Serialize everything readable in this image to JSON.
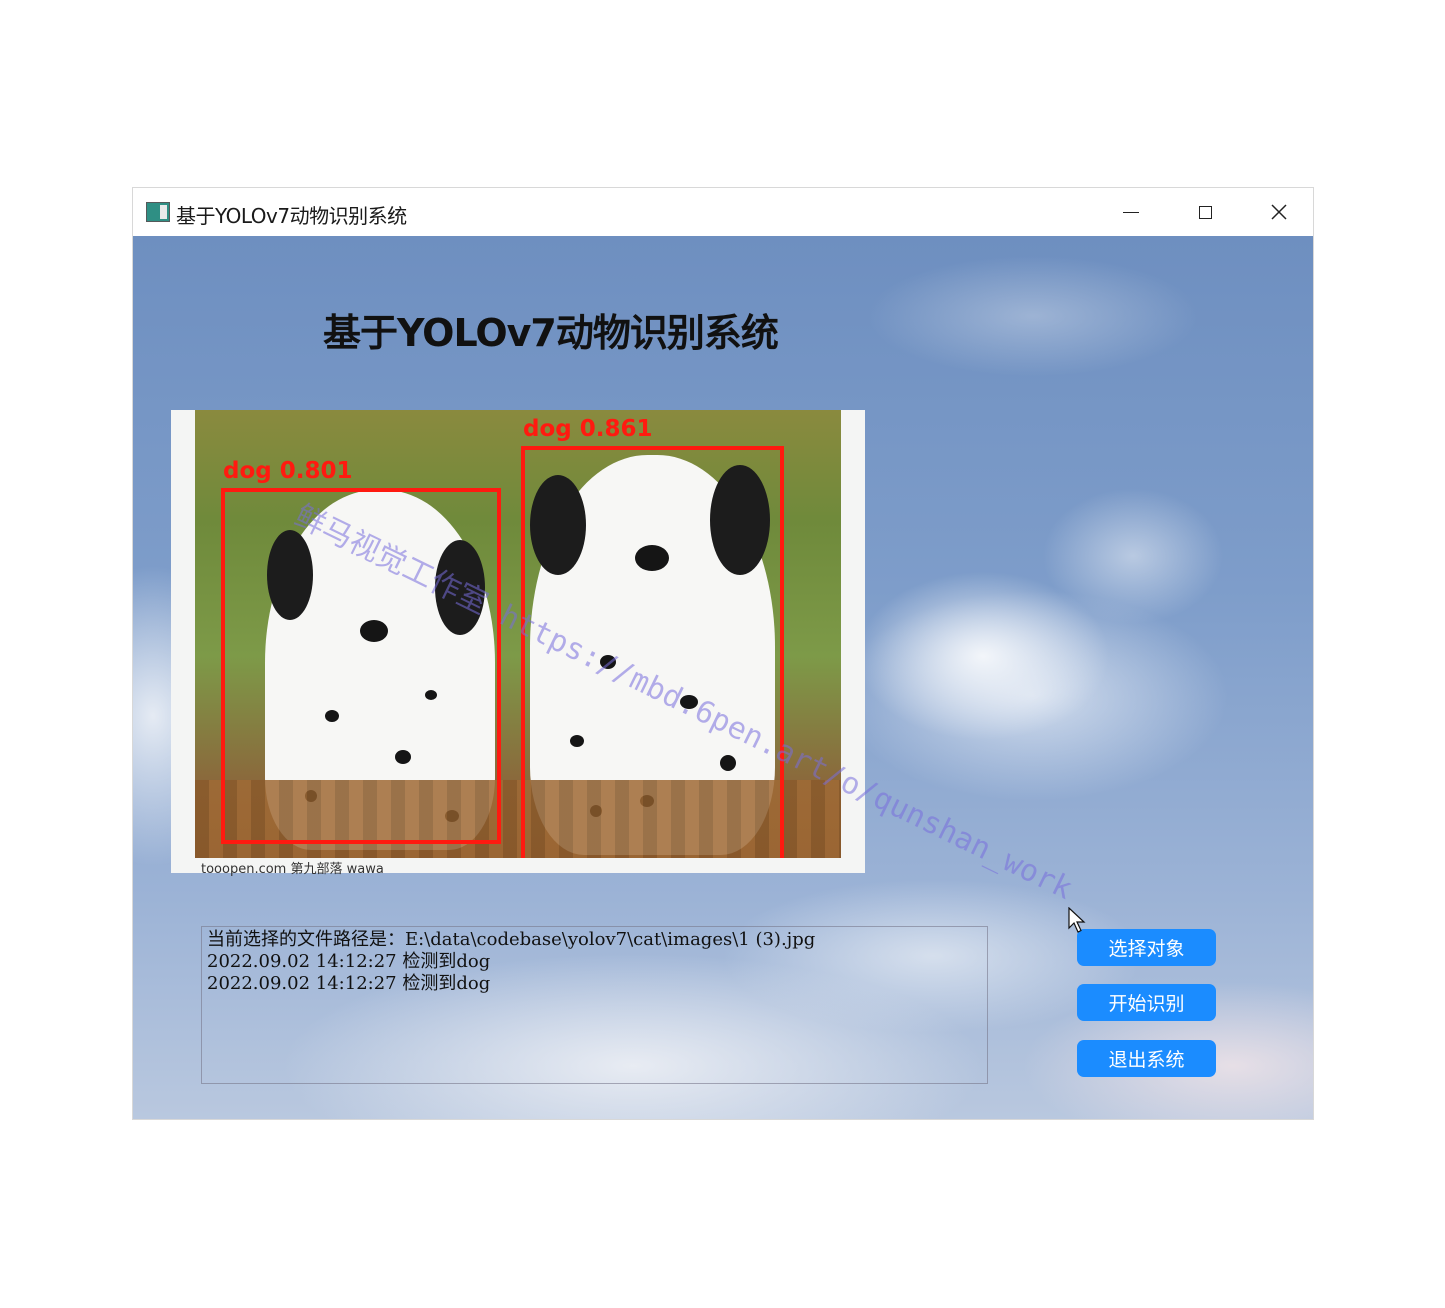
{
  "window": {
    "title": "基于YOLOv7动物识别系统",
    "controls": [
      "minimize",
      "maximize",
      "close"
    ]
  },
  "app": {
    "title": "基于YOLOv7动物识别系统"
  },
  "detection": {
    "boxes": [
      {
        "label": "dog 0.801"
      },
      {
        "label": "dog 0.861"
      }
    ],
    "box_color": "#ff1a10",
    "image_credit": "tooopen.com 第九部落  wawa",
    "watermark": "鲜马视觉工作室 https://mbd.6pen.art/o/qunshan_work"
  },
  "log": {
    "lines": [
      "当前选择的文件路径是：E:\\data\\codebase\\yolov7\\cat\\images\\1 (3).jpg",
      "2022.09.02 14:12:27 检测到dog",
      "2022.09.02 14:12:27 检测到dog"
    ]
  },
  "buttons": {
    "select": "选择对象",
    "start": "开始识别",
    "exit": "退出系统"
  },
  "colors": {
    "button_bg": "#1b8cff",
    "button_text": "#ffffff"
  }
}
